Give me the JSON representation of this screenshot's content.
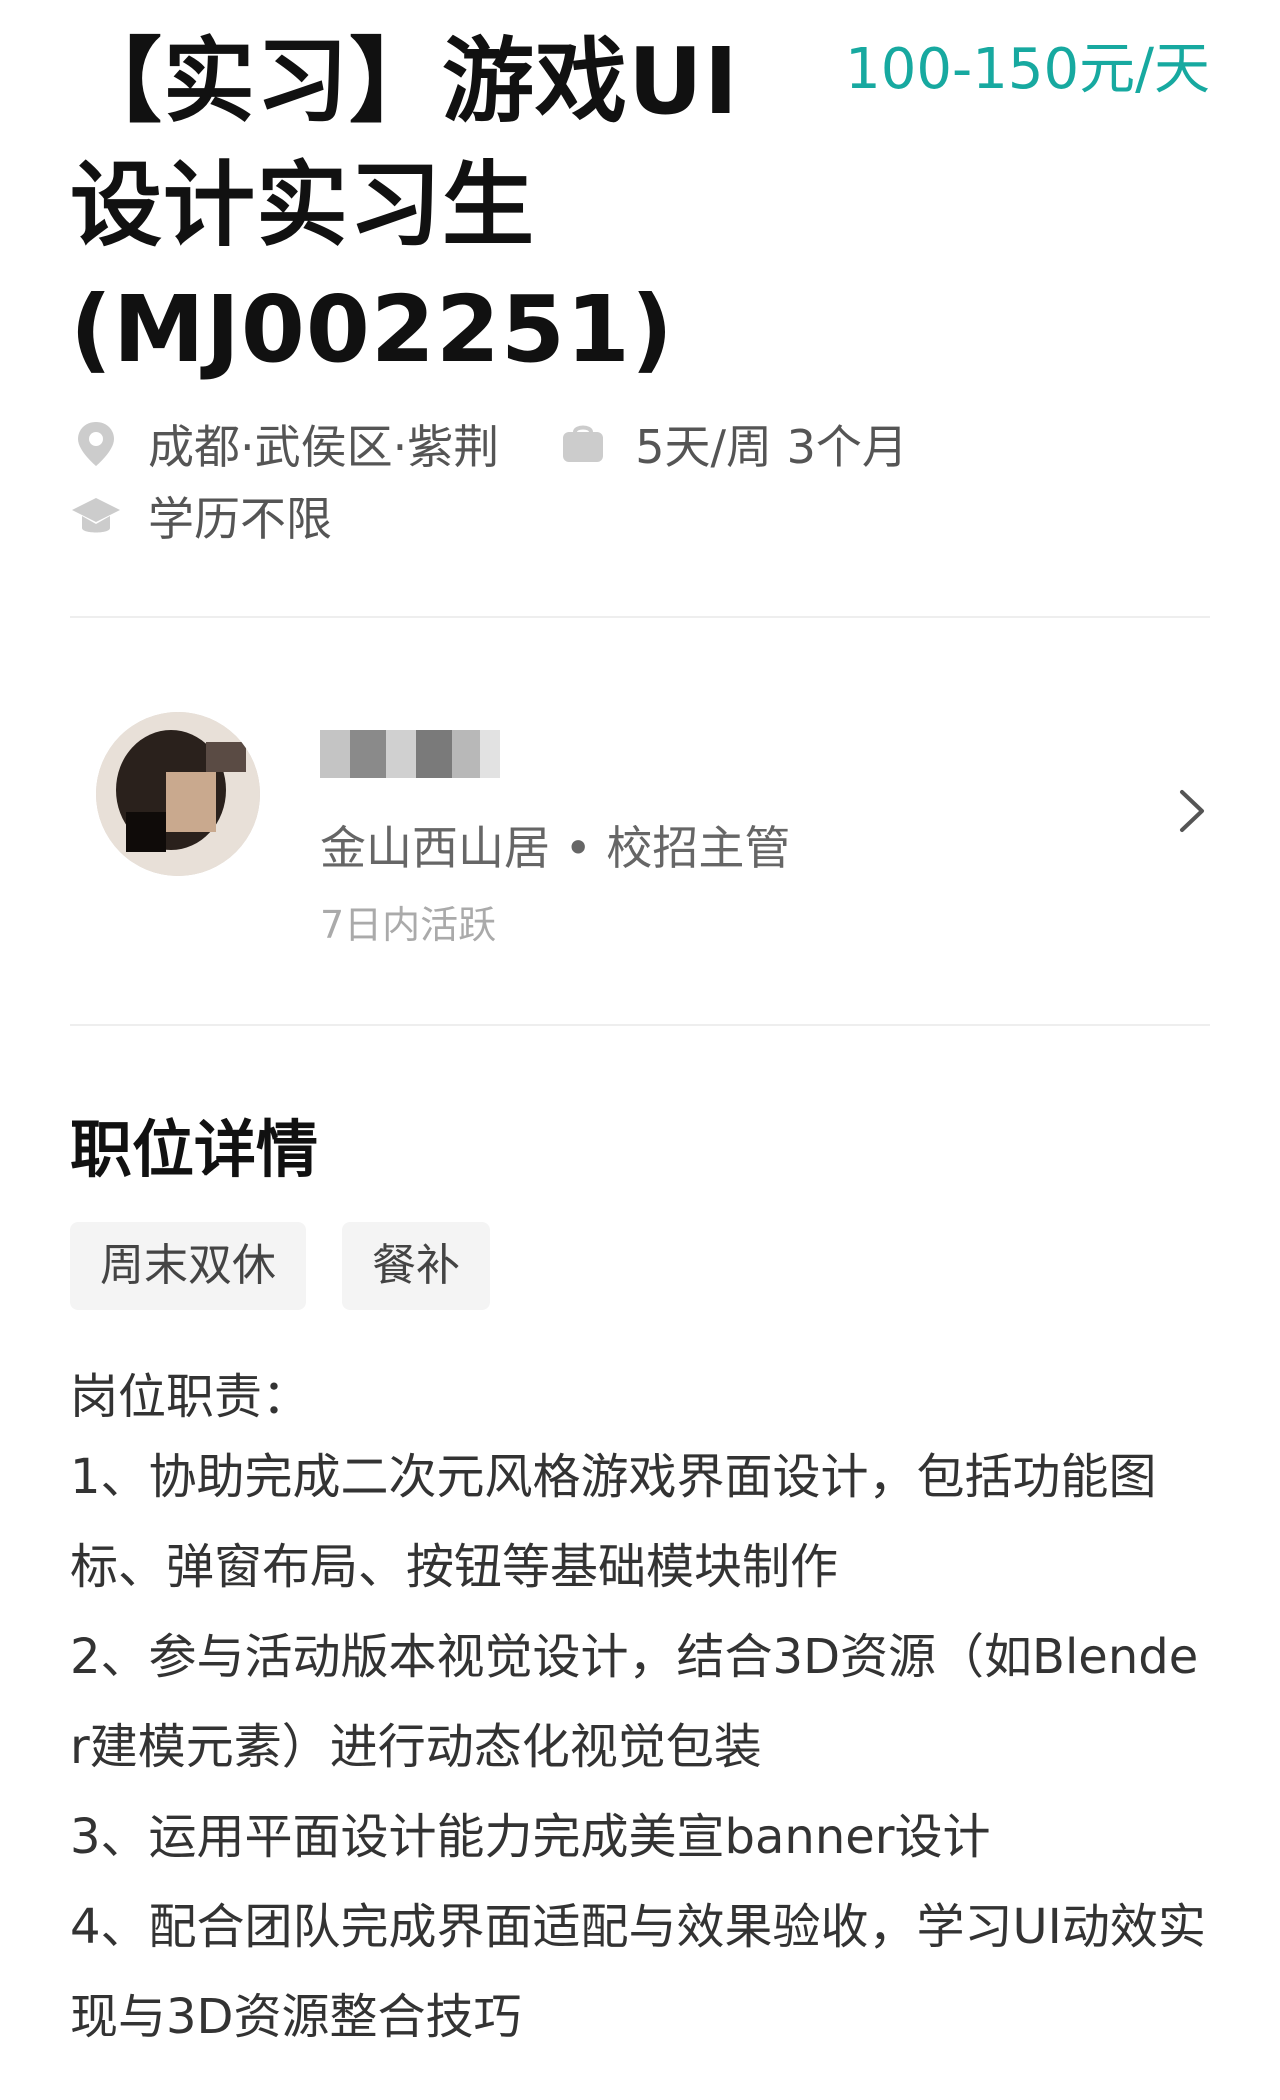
{
  "job": {
    "title": "【实习】游戏UI设计实习生(MJ002251)",
    "salary": "100-150元/天",
    "location": "成都·武侯区·紫荆",
    "schedule": "5天/周 3个月",
    "education": "学历不限"
  },
  "recruiter": {
    "info": "金山西山居 • 校招主管",
    "active": "7日内活跃"
  },
  "details": {
    "section_title": "职位详情",
    "tags": [
      "周末双休",
      "餐补"
    ],
    "duties_title": "岗位职责：",
    "duties": [
      "1、协助完成二次元风格游戏界面设计，包括功能图标、弹窗布局、按钮等基础模块制作",
      "2、参与活动版本视觉设计，结合3D资源（如Blender建模元素）进行动态化视觉包装",
      "3、运用平面设计能力完成美宣banner设计",
      "4、配合团队完成界面适配与效果验收，学习UI动效实现与3D资源整合技巧"
    ]
  },
  "colors": {
    "salary": "#17a9a0",
    "icon": "#cccccc",
    "divider": "#eeeeee"
  },
  "icons": {
    "location": "location-pin-icon",
    "schedule": "briefcase-icon",
    "education": "graduation-cap-icon",
    "chevron": "chevron-right-icon"
  }
}
